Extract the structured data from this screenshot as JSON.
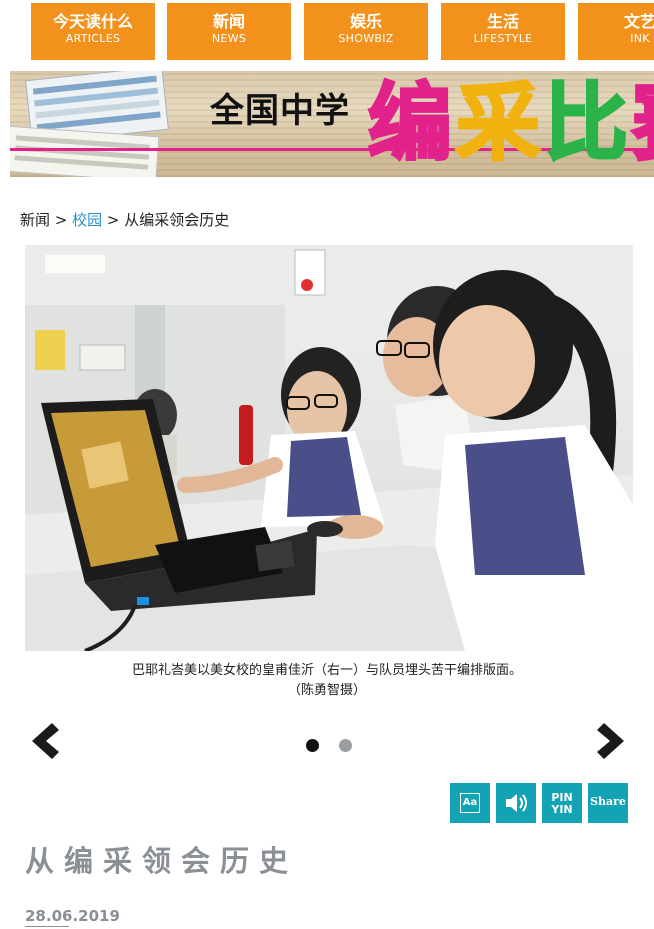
{
  "nav": {
    "items": [
      {
        "zh": "今天读什么",
        "en": "ARTICLES"
      },
      {
        "zh": "新闻",
        "en": "NEWS"
      },
      {
        "zh": "娱乐",
        "en": "SHOWBIZ"
      },
      {
        "zh": "生活",
        "en": "LIFESTYLE"
      },
      {
        "zh": "文艺",
        "en": "INK"
      }
    ],
    "color": "#f2921c"
  },
  "banner": {
    "black_text": "全国中学",
    "color_chars": [
      {
        "char": "编",
        "color": "#e0228a"
      },
      {
        "char": "采",
        "color": "#f0b20f"
      },
      {
        "char": "比",
        "color": "#2bb34a"
      },
      {
        "char": "赛",
        "color": "#e0228a"
      }
    ]
  },
  "breadcrumb": {
    "home": "新闻",
    "sep1": " > ",
    "section": "校园",
    "sep2": " > ",
    "current": "从编采领会历史"
  },
  "photo": {
    "caption_line1": "巴耶礼峇美以美女校的皇甫佳沂（右一）与队员埋头苦干编排版面。",
    "caption_line2": "（陈勇智摄）"
  },
  "carousel": {
    "prev_icon": "chevron-left-icon",
    "next_icon": "chevron-right-icon",
    "active_dot_color": "#111111",
    "inactive_dot_color": "#9a9ea3"
  },
  "tools": {
    "font_size_label": "Aa",
    "audio_icon": "speaker-icon",
    "pinyin_line1": "PIN",
    "pinyin_line2": "YIN",
    "share_label": "Share",
    "color": "#14a3b4"
  },
  "article": {
    "title": "从编采领会历史",
    "date": "28.06.2019"
  }
}
